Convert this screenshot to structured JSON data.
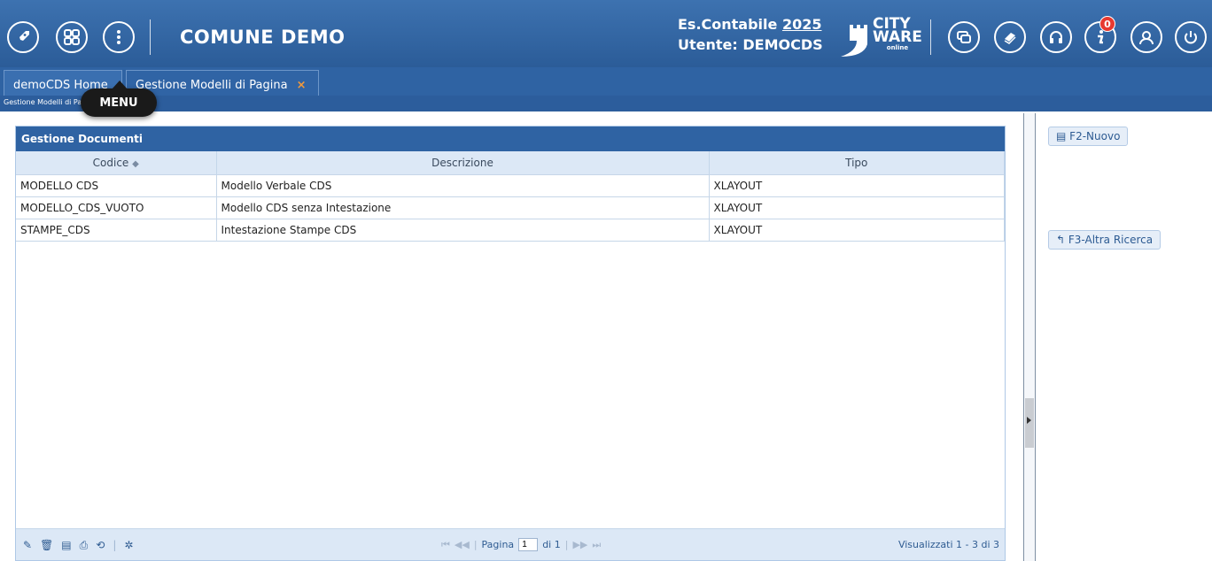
{
  "header": {
    "title": "COMUNE DEMO",
    "es_label": "Es.Contabile",
    "es_year": "2025",
    "user_label": "Utente: DEMOCDS",
    "logo_line1": "CITY",
    "logo_line2": "WARE",
    "logo_line3": "online",
    "notification_count": "0",
    "left_icons": [
      "rocket-icon",
      "apps-grid-icon",
      "info-dots-icon"
    ],
    "right_icons": [
      "windows-icon",
      "book-icon",
      "headset-icon",
      "info-icon",
      "user-icon",
      "power-icon"
    ]
  },
  "tabs": [
    {
      "label": "demoCDS Home"
    },
    {
      "label": "Gestione Modelli di Pagina",
      "close": "×"
    }
  ],
  "breadcrumb": "Gestione Modelli di Pagina",
  "tooltip": "MENU",
  "grid": {
    "title": "Gestione Documenti",
    "columns": [
      "Codice",
      "Descrizione",
      "Tipo"
    ],
    "sort_indicator": "◆",
    "rows": [
      [
        "MODELLO CDS",
        "Modello Verbale CDS",
        "XLAYOUT"
      ],
      [
        "MODELLO_CDS_VUOTO",
        "Modello CDS senza Intestazione",
        "XLAYOUT"
      ],
      [
        "STAMPE_CDS",
        "Intestazione Stampe CDS",
        "XLAYOUT"
      ]
    ],
    "pager": {
      "page_label": "Pagina",
      "page_value": "1",
      "of_label": "di 1",
      "count": "Visualizzati 1 - 3 di 3"
    },
    "footer_icons": [
      "edit-icon",
      "delete-icon",
      "excel-icon",
      "print-icon",
      "refresh-icon",
      "settings-icon"
    ]
  },
  "side": {
    "new_label": "F2-Nuovo",
    "search_label": "F3-Altra Ricerca"
  },
  "colors": {
    "header_bg": "#2f63a3",
    "accent_orange": "#f39a3a",
    "badge_red": "#e7392f"
  }
}
